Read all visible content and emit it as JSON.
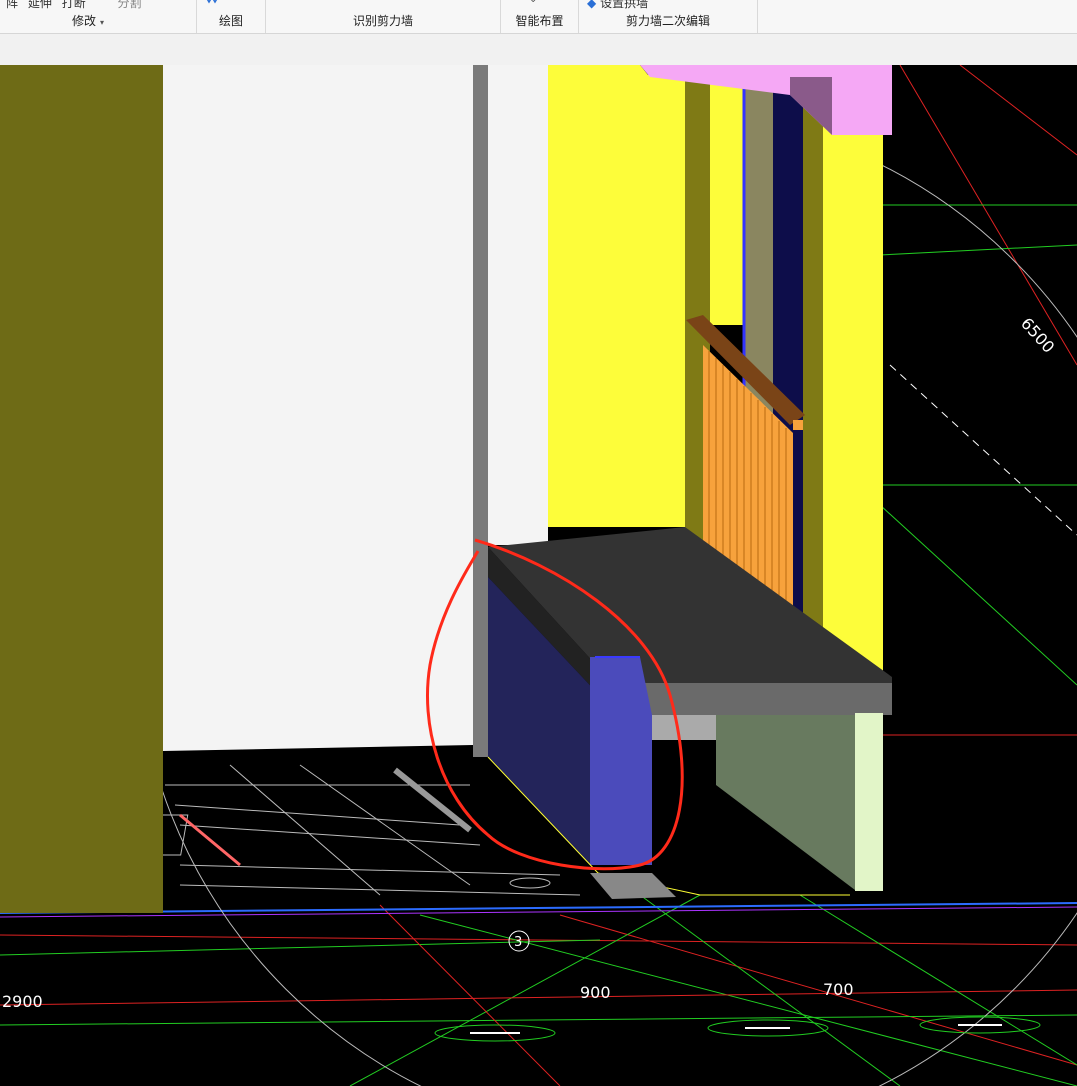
{
  "ribbon": {
    "groups": [
      {
        "id": "modify",
        "label": "修改",
        "dropdown": "▾",
        "partial_items": [
          "阵",
          "延伸",
          "打断",
          "分割"
        ]
      },
      {
        "id": "draw",
        "label": "绘图"
      },
      {
        "id": "recognize",
        "label": "识别剪力墙"
      },
      {
        "id": "smart",
        "label": "智能布置"
      },
      {
        "id": "edit2",
        "label": "剪力墙二次编辑",
        "partial_items": [
          "设置拱墙"
        ]
      }
    ]
  },
  "viewport": {
    "dimension_labels": {
      "d6500": "6500",
      "d2900": "2900",
      "d900": "900",
      "d700": "700",
      "axis3": "3"
    },
    "colors": {
      "background": "#000000",
      "olive_wall": "#6e6b16",
      "white_wall": "#f4f4f4",
      "yellow_wall": "#fdfd3a",
      "slab_dark": "#333333",
      "navy_wall": "#23245a",
      "blue_wall": "#4b4bbb",
      "railing_orange": "#f7a23c",
      "railing_top": "#7a4417",
      "pink_beam": "#f5a8f5",
      "annotation_red": "#ff2a1a"
    }
  }
}
